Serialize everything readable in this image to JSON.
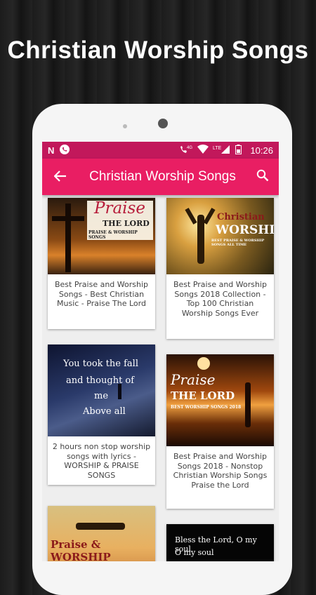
{
  "promo": {
    "title": "Christian Worship Songs"
  },
  "statusbar": {
    "network_label": "4G",
    "lte_label": "LTE",
    "time": "10:26",
    "n_label": "N"
  },
  "appbar": {
    "title": "Christian Worship Songs",
    "back_icon": "arrow-left-icon",
    "search_icon": "search-icon"
  },
  "colors": {
    "statusbar": "#c2185b",
    "appbar": "#e91e63"
  },
  "cards": [
    {
      "caption": "Best Praise and Worship Songs - Best Christian Music - Praise The Lord",
      "thumb_lines": [
        "Praise",
        "THE LORD",
        "PRAISE & WORSHIP SONGS"
      ]
    },
    {
      "caption": "Best Praise and Worship Songs 2018 Collection - Top 100 Christian Worship Songs Ever",
      "thumb_lines": [
        "Christian",
        "WORSHIP",
        "BEST PRAISE & WORSHIP SONGS ALL TIME"
      ]
    },
    {
      "caption": "2 hours non stop worship songs with lyrics - WORSHIP & PRAISE SONGS",
      "thumb_lines": [
        "You took the fall",
        "and thought of",
        "me",
        "Above all"
      ]
    },
    {
      "caption": "Best Praise and Worship Songs 2018 - Nonstop Christian Worship Songs Praise the Lord",
      "thumb_lines": [
        "Praise",
        "THE LORD",
        "BEST WORSHIP SONGS 2018"
      ]
    },
    {
      "caption": "",
      "thumb_lines": [
        "Praise &",
        "WORSHIP"
      ]
    },
    {
      "caption": "",
      "thumb_lines": [
        "Bless the Lord, O my soul",
        "O my soul"
      ]
    }
  ]
}
